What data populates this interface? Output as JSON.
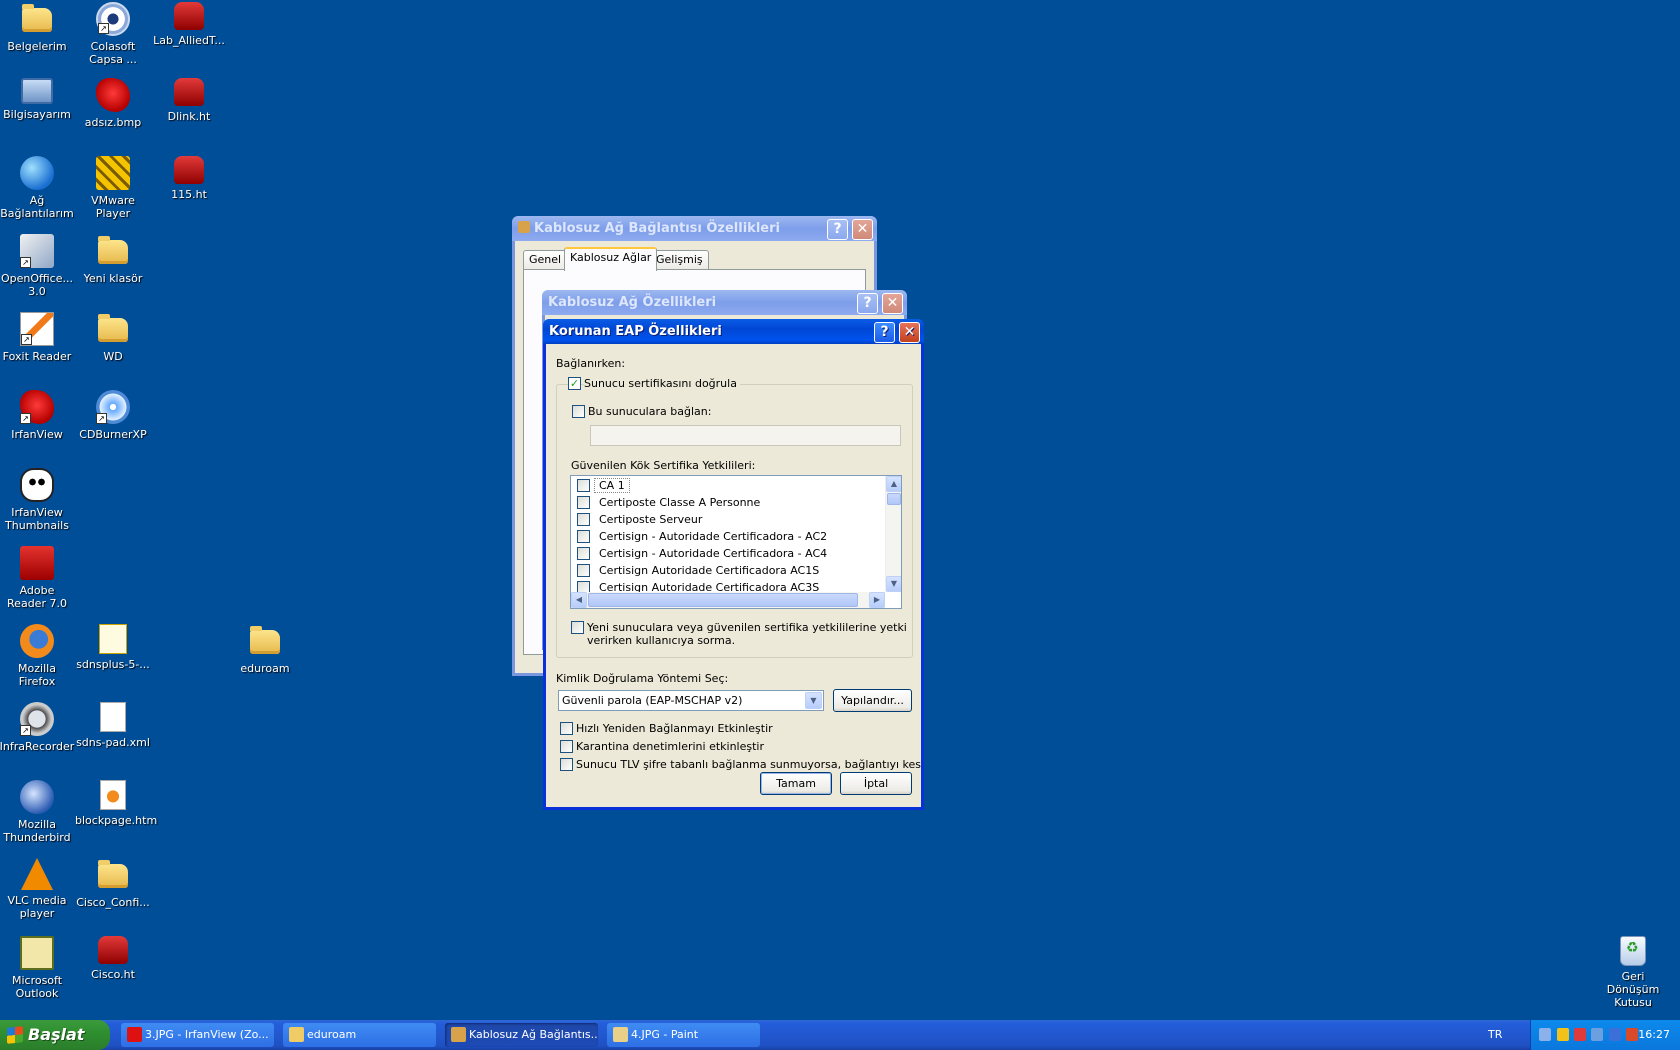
{
  "desktop_icons": [
    {
      "name": "belgelerim",
      "label": "Belgelerim",
      "icon": "my-documents-icon"
    },
    {
      "name": "colasoft",
      "label": "Colasoft Capsa ...",
      "icon": "colasoft-eye-icon"
    },
    {
      "name": "lab-alliedt",
      "label": "Lab_AlliedT...",
      "icon": "hyperterminal-phone-icon"
    },
    {
      "name": "bilgisayarim",
      "label": "Bilgisayarım",
      "icon": "my-computer-icon"
    },
    {
      "name": "adsiz-bmp",
      "label": "adsız.bmp",
      "icon": "irfanview-icon"
    },
    {
      "name": "dlink-ht",
      "label": "Dlink.ht",
      "icon": "hyperterminal-phone-icon"
    },
    {
      "name": "ag-baglantilarim",
      "label": "Ağ Bağlantılarım",
      "icon": "network-connections-icon"
    },
    {
      "name": "vmware",
      "label": "VMware Player",
      "icon": "vmware-icon"
    },
    {
      "name": "115-ht",
      "label": "115.ht",
      "icon": "hyperterminal-phone-icon"
    },
    {
      "name": "openoffice",
      "label": "OpenOffice... 3.0",
      "icon": "openoffice-icon"
    },
    {
      "name": "yeni-klasor",
      "label": "Yeni klasör",
      "icon": "folder-icon"
    },
    {
      "name": "foxit",
      "label": "Foxit Reader",
      "icon": "foxit-icon"
    },
    {
      "name": "wd",
      "label": "WD",
      "icon": "folder-icon"
    },
    {
      "name": "irfanview",
      "label": "IrfanView",
      "icon": "irfanview-icon"
    },
    {
      "name": "cdburner",
      "label": "CDBurnerXP",
      "icon": "cdburner-icon"
    },
    {
      "name": "irfan-thumbs",
      "label": "IrfanView Thumbnails",
      "icon": "panda-icon"
    },
    {
      "name": "adobe",
      "label": "Adobe Reader 7.0",
      "icon": "adobe-reader-icon"
    },
    {
      "name": "firefox",
      "label": "Mozilla Firefox",
      "icon": "firefox-icon"
    },
    {
      "name": "sdnsplus",
      "label": "sdnsplus-5-...",
      "icon": "pdf-icon"
    },
    {
      "name": "eduroam",
      "label": "eduroam",
      "icon": "folder-icon"
    },
    {
      "name": "infrarecorder",
      "label": "InfraRecorder",
      "icon": "infrarecorder-icon"
    },
    {
      "name": "sdns-pad",
      "label": "sdns-pad.xml",
      "icon": "xml-file-icon"
    },
    {
      "name": "thunderbird",
      "label": "Mozilla Thunderbird",
      "icon": "thunderbird-icon"
    },
    {
      "name": "blockpage",
      "label": "blockpage.htm",
      "icon": "html-file-icon"
    },
    {
      "name": "vlc",
      "label": "VLC media player",
      "icon": "vlc-icon"
    },
    {
      "name": "cisco-confi",
      "label": "Cisco_Confi...",
      "icon": "folder-icon"
    },
    {
      "name": "outlook",
      "label": "Microsoft Outlook",
      "icon": "outlook-icon"
    },
    {
      "name": "cisco-ht",
      "label": "Cisco.ht",
      "icon": "hyperterminal-phone-icon"
    },
    {
      "name": "recycle-bin",
      "label": "Geri Dönüşüm Kutusu",
      "icon": "recycle-bin-icon"
    }
  ],
  "win1": {
    "title": "Kablosuz Ağ Bağlantısı Özellikleri",
    "tabs": [
      "Genel",
      "Kablosuz Ağlar",
      "Gelişmiş"
    ]
  },
  "win2": {
    "title": "Kablosuz Ağ Özellikleri"
  },
  "dialog": {
    "title": "Korunan EAP Özellikleri",
    "connecting_label": "Bağlanırken:",
    "validate_cert": {
      "label": "Sunucu sertifikasını doğrula",
      "checked": true
    },
    "connect_servers": {
      "label": "Bu sunuculara bağlan:",
      "checked": false,
      "value": ""
    },
    "trusted_root_label": "Güvenilen Kök Sertifika Yetkilileri:",
    "cert_list": [
      "CA 1",
      "Certiposte Classe A Personne",
      "Certiposte Serveur",
      "Certisign - Autoridade Certificadora - AC2",
      "Certisign - Autoridade Certificadora - AC4",
      "Certisign Autoridade Certificadora AC1S",
      "Certisign Autoridade Certificadora AC3S"
    ],
    "no_prompt": {
      "label_line1": "Yeni sunuculara veya güvenilen sertifika yetkililerine yetki",
      "label_line2": "verirken kullanıcıya sorma.",
      "checked": false
    },
    "auth_method_label": "Kimlik Doğrulama Yöntemi Seç:",
    "auth_method_value": "Güvenli parola (EAP-MSCHAP v2)",
    "configure_label": "Yapılandır...",
    "fast_reconnect": {
      "label": "Hızlı Yeniden Bağlanmayı Etkinleştir",
      "checked": false
    },
    "quarantine": {
      "label": "Karantina denetimlerini etkinleştir",
      "checked": false
    },
    "tlv": {
      "label": "Sunucu TLV şifre tabanlı bağlanma sunmuyorsa, bağlantıyı kes",
      "checked": false
    },
    "ok_label": "Tamam",
    "cancel_label": "İptal"
  },
  "taskbar": {
    "start_label": "Başlat",
    "tasks": [
      {
        "label": "3.JPG - IrfanView (Zo...",
        "icon": "irfanview-icon"
      },
      {
        "label": "eduroam",
        "icon": "folder-icon"
      },
      {
        "label": "Kablosuz Ağ Bağlantıs...",
        "icon": "network-icon"
      },
      {
        "label": "4.JPG - Paint",
        "icon": "paint-icon"
      }
    ],
    "language": "TR",
    "clock": "16:27"
  },
  "colors": {
    "desktop": "#004e98",
    "titlebar": "#0054e3",
    "dialog_bg": "#ece9d8"
  }
}
